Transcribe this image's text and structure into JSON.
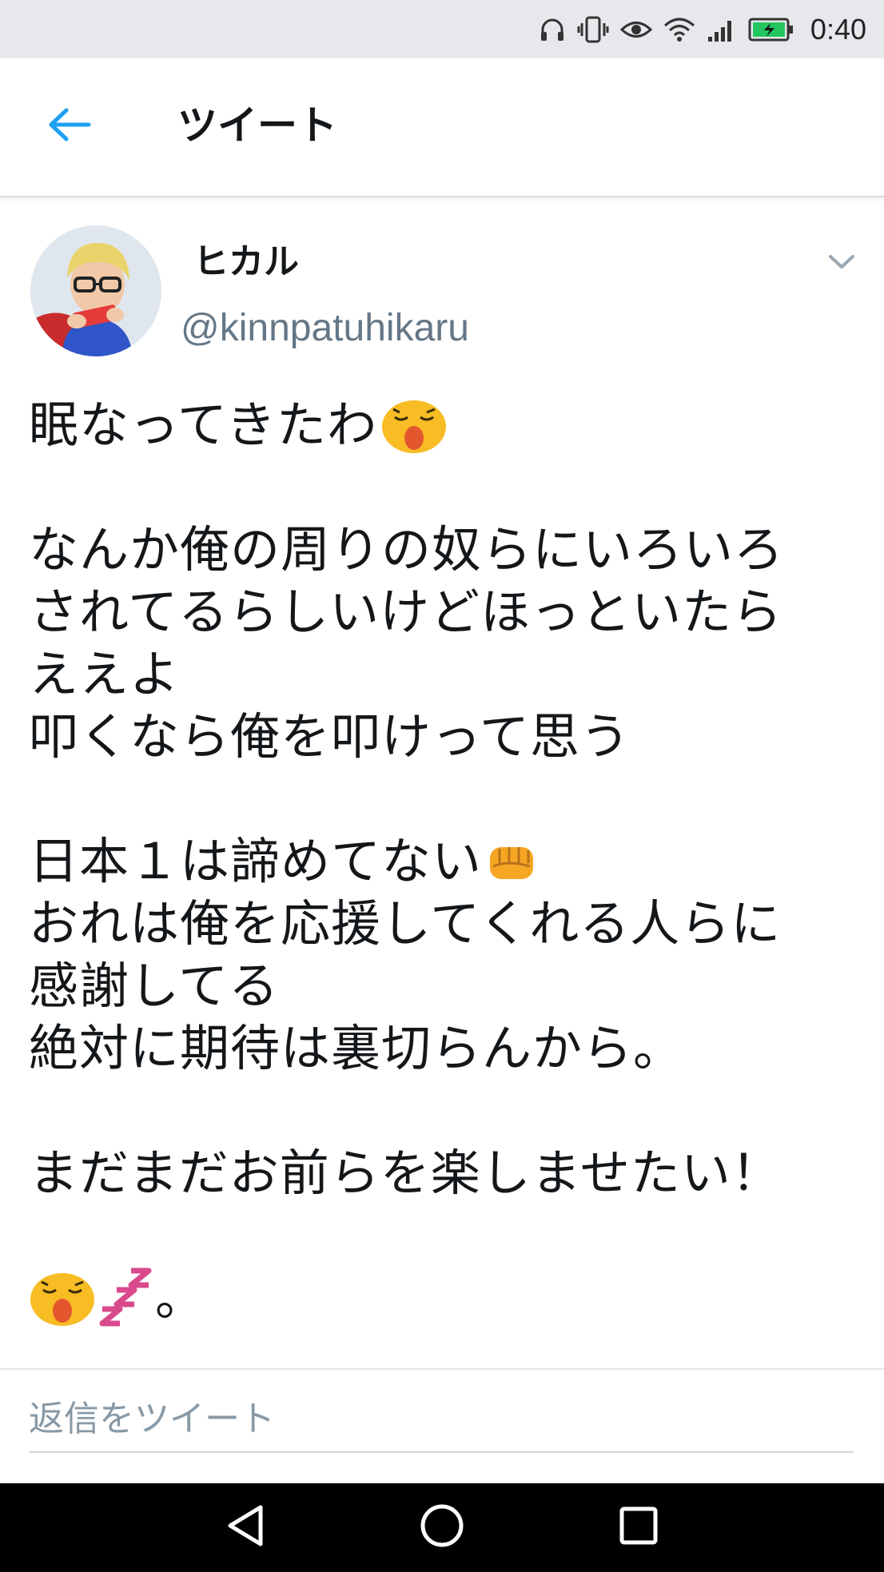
{
  "status_bar": {
    "time": "0:40",
    "icons": [
      "headphones-icon",
      "vibrate-icon",
      "eye-icon",
      "wifi-icon",
      "signal-icon",
      "battery-charging-icon"
    ],
    "battery_color": "#22c55e"
  },
  "header": {
    "back_icon": "arrow-left-icon",
    "title": "ツイート",
    "accent_color": "#1da1f2"
  },
  "tweet": {
    "author": {
      "display_name": "ヒカル",
      "handle": "@kinnpatuhikaru",
      "avatar": "profile-photo"
    },
    "menu_icon": "chevron-down-icon",
    "lines": {
      "l1": "眠なってきたわ",
      "l2": "なんか俺の周りの奴らにいろいろ",
      "l3": "されてるらしいけどほっといたら",
      "l4": "ええよ",
      "l5": "叩くなら俺を叩けって思う",
      "l6": "日本１は諦めてない",
      "l7": "おれは俺を応援してくれる人らに",
      "l8": "感謝してる",
      "l9": "絶対に期待は裏切らんから。",
      "l10": "まだまだお前らを楽しませたい！",
      "l11": "。"
    },
    "emojis": {
      "l1": "sleepy-yawn-emoji",
      "l6": "fist-emoji",
      "l11a": "sleepy-yawn-emoji",
      "l11b": "zzz-emoji"
    }
  },
  "reply": {
    "placeholder": "返信をツイート"
  },
  "nav_bar": {
    "buttons": [
      "back-triangle-icon",
      "home-circle-icon",
      "recents-square-icon"
    ]
  }
}
